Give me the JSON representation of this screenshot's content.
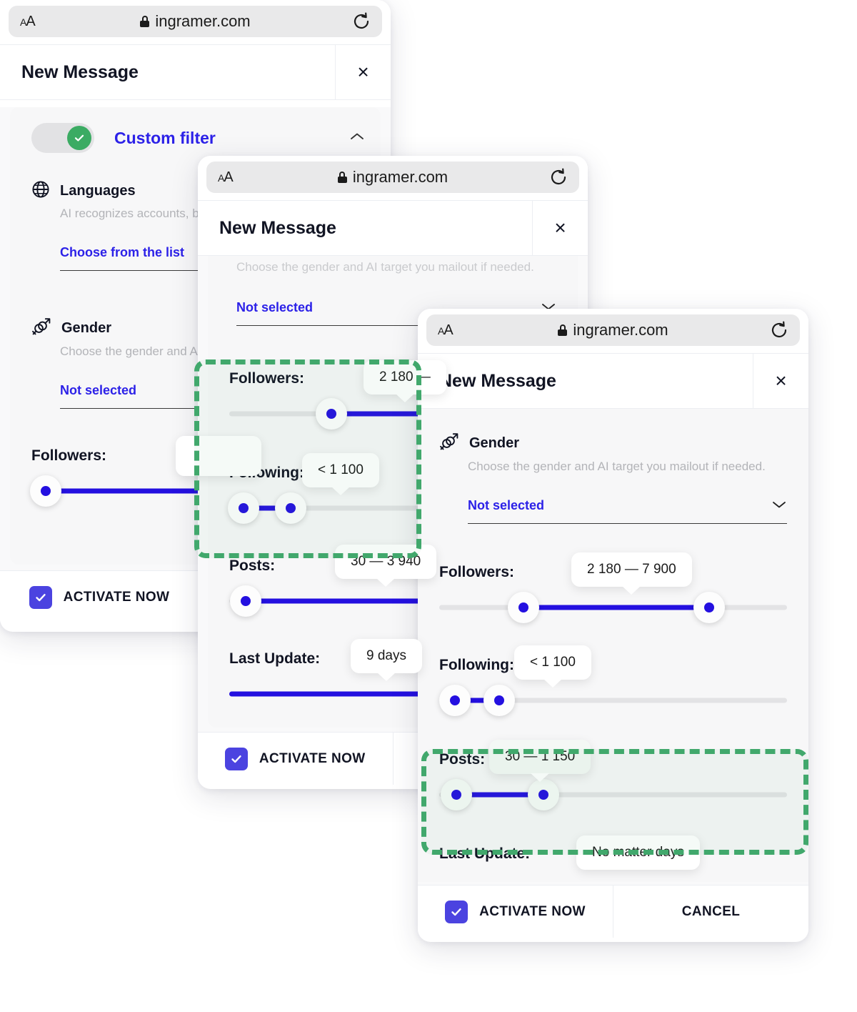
{
  "browser": {
    "text_size_label": "AA",
    "url": "ingramer.com",
    "lock_icon": "lock-icon",
    "reload_icon": "reload-icon"
  },
  "modal": {
    "title": "New Message",
    "close_label": "×"
  },
  "window1": {
    "custom_filter": {
      "label": "Custom filter",
      "toggle_on": true,
      "chevron": "chevron-up-icon"
    },
    "languages": {
      "icon": "globe-icon",
      "title": "Languages",
      "description": "AI recognizes accounts, bios,",
      "value": "Choose from the list"
    },
    "gender": {
      "icon": "gender-icon",
      "title": "Gender",
      "description": "Choose the gender and AI ta",
      "value": "Not selected"
    },
    "followers": {
      "label": "Followers:"
    },
    "footer": {
      "activate": "ACTIVATE NOW"
    }
  },
  "window2": {
    "gender_desc": "Choose the gender and AI target you mailout if needed.",
    "gender_value": "Not selected",
    "followers": {
      "label": "Followers:",
      "bubble": "2 180 —"
    },
    "following": {
      "label": "Following:",
      "bubble": "< 1 100"
    },
    "posts": {
      "label": "Posts:",
      "bubble": "30 — 3 940"
    },
    "last_update": {
      "label": "Last Update:",
      "bubble": "9 days"
    },
    "footer": {
      "activate": "ACTIVATE NOW"
    }
  },
  "window3": {
    "gender": {
      "icon": "gender-icon",
      "title": "Gender",
      "description": "Choose the gender and AI target you mailout if needed.",
      "value": "Not selected",
      "chevron": "chevron-down-icon"
    },
    "followers": {
      "label": "Followers:",
      "bubble": "2 180 — 7 900"
    },
    "following": {
      "label": "Following:",
      "bubble": "< 1 100"
    },
    "posts": {
      "label": "Posts:",
      "bubble": "30 — 1 150"
    },
    "last_update": {
      "label": "Last Update:",
      "bubble": "No matter days"
    },
    "footer": {
      "activate": "ACTIVATE NOW",
      "cancel": "CANCEL"
    }
  },
  "colors": {
    "accent_blue": "#2410e0",
    "link_blue": "#2c21e8",
    "checkbox_purple": "#4b43e0",
    "toggle_green": "#3bab63",
    "highlight_green": "#41a86c",
    "track_gray": "#e3e3e5"
  }
}
